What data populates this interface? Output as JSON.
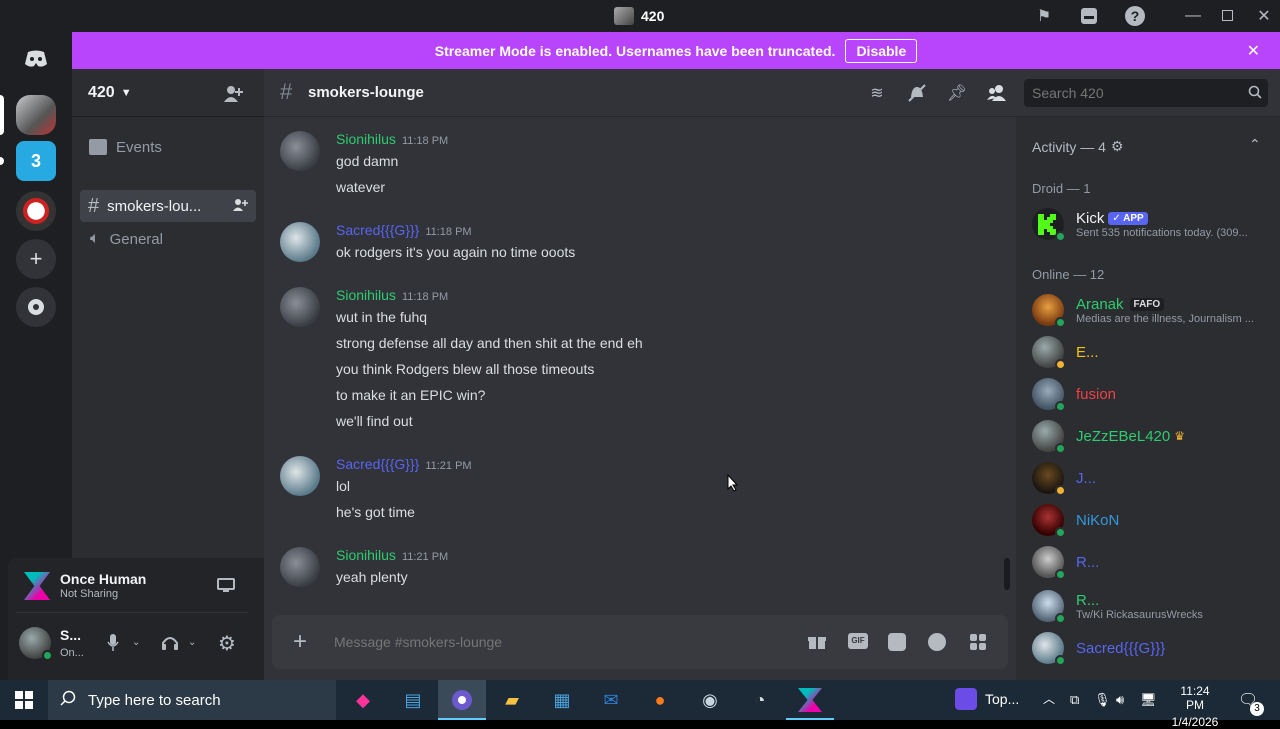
{
  "window": {
    "title": "420"
  },
  "banner": {
    "text": "Streamer Mode is enabled. Usernames have been truncated.",
    "disable_label": "Disable"
  },
  "server": {
    "name": "420"
  },
  "channels": [
    {
      "label": "Events"
    },
    {
      "label": "smokers-lou..."
    },
    {
      "label": "General"
    }
  ],
  "header": {
    "channel": "smokers-lounge",
    "search_placeholder": "Search 420"
  },
  "messages": [
    {
      "author": "Sionihilus",
      "time": "11:18 PM",
      "lines": [
        "god damn",
        "watever"
      ]
    },
    {
      "author": "Sacred{{{G}}}",
      "time": "11:18 PM",
      "lines": [
        "ok rodgers it's you again no time ooots"
      ]
    },
    {
      "author": "Sionihilus",
      "time": "11:18 PM",
      "lines": [
        "wut in the fuhq",
        "strong defense all day and then shit at the end eh",
        "you think Rodgers blew all those timeouts",
        "to make it an EPIC win?",
        "we'll find out"
      ]
    },
    {
      "author": "Sacred{{{G}}}",
      "time": "11:21 PM",
      "lines": [
        "lol",
        "he's got time"
      ]
    },
    {
      "author": "Sionihilus",
      "time": "11:21 PM",
      "lines": [
        "yeah plenty"
      ]
    }
  ],
  "composer": {
    "placeholder": "Message #smokers-lounge"
  },
  "activity": {
    "label": "Activity — 4"
  },
  "groups": {
    "droid": "Droid — 1",
    "online": "Online — 12"
  },
  "members": {
    "kick": {
      "name": "Kick",
      "badge": "✓ APP",
      "sub": "Sent 535 notifications today. (309..."
    },
    "aranak": {
      "name": "Aranak",
      "tag": "FAFO",
      "sub": "Medias are the illness, Journalism ..."
    },
    "e": {
      "name": "E..."
    },
    "fusion": {
      "name": "fusion"
    },
    "jezze": {
      "name": "JeZzEBeL420"
    },
    "j": {
      "name": "J..."
    },
    "nikon": {
      "name": "NiKoN"
    },
    "r1": {
      "name": "R..."
    },
    "r2": {
      "name": "R...",
      "sub": "Tw/Ki RickasaurusWrecks"
    },
    "sacred": {
      "name": "Sacred{{{G}}}"
    }
  },
  "activity_panel": {
    "game": "Once Human",
    "status": "Not Sharing"
  },
  "user": {
    "name": "S...",
    "status": "On..."
  },
  "taskbar": {
    "search_placeholder": "Type here to search",
    "top_label": "Top...",
    "time": "11:24 PM",
    "date": "1/4/2026",
    "notif_count": "3"
  },
  "colors": {
    "banner": "#b845fc",
    "sionihilus": "#2ecc71",
    "sacred": "#5865f2"
  }
}
